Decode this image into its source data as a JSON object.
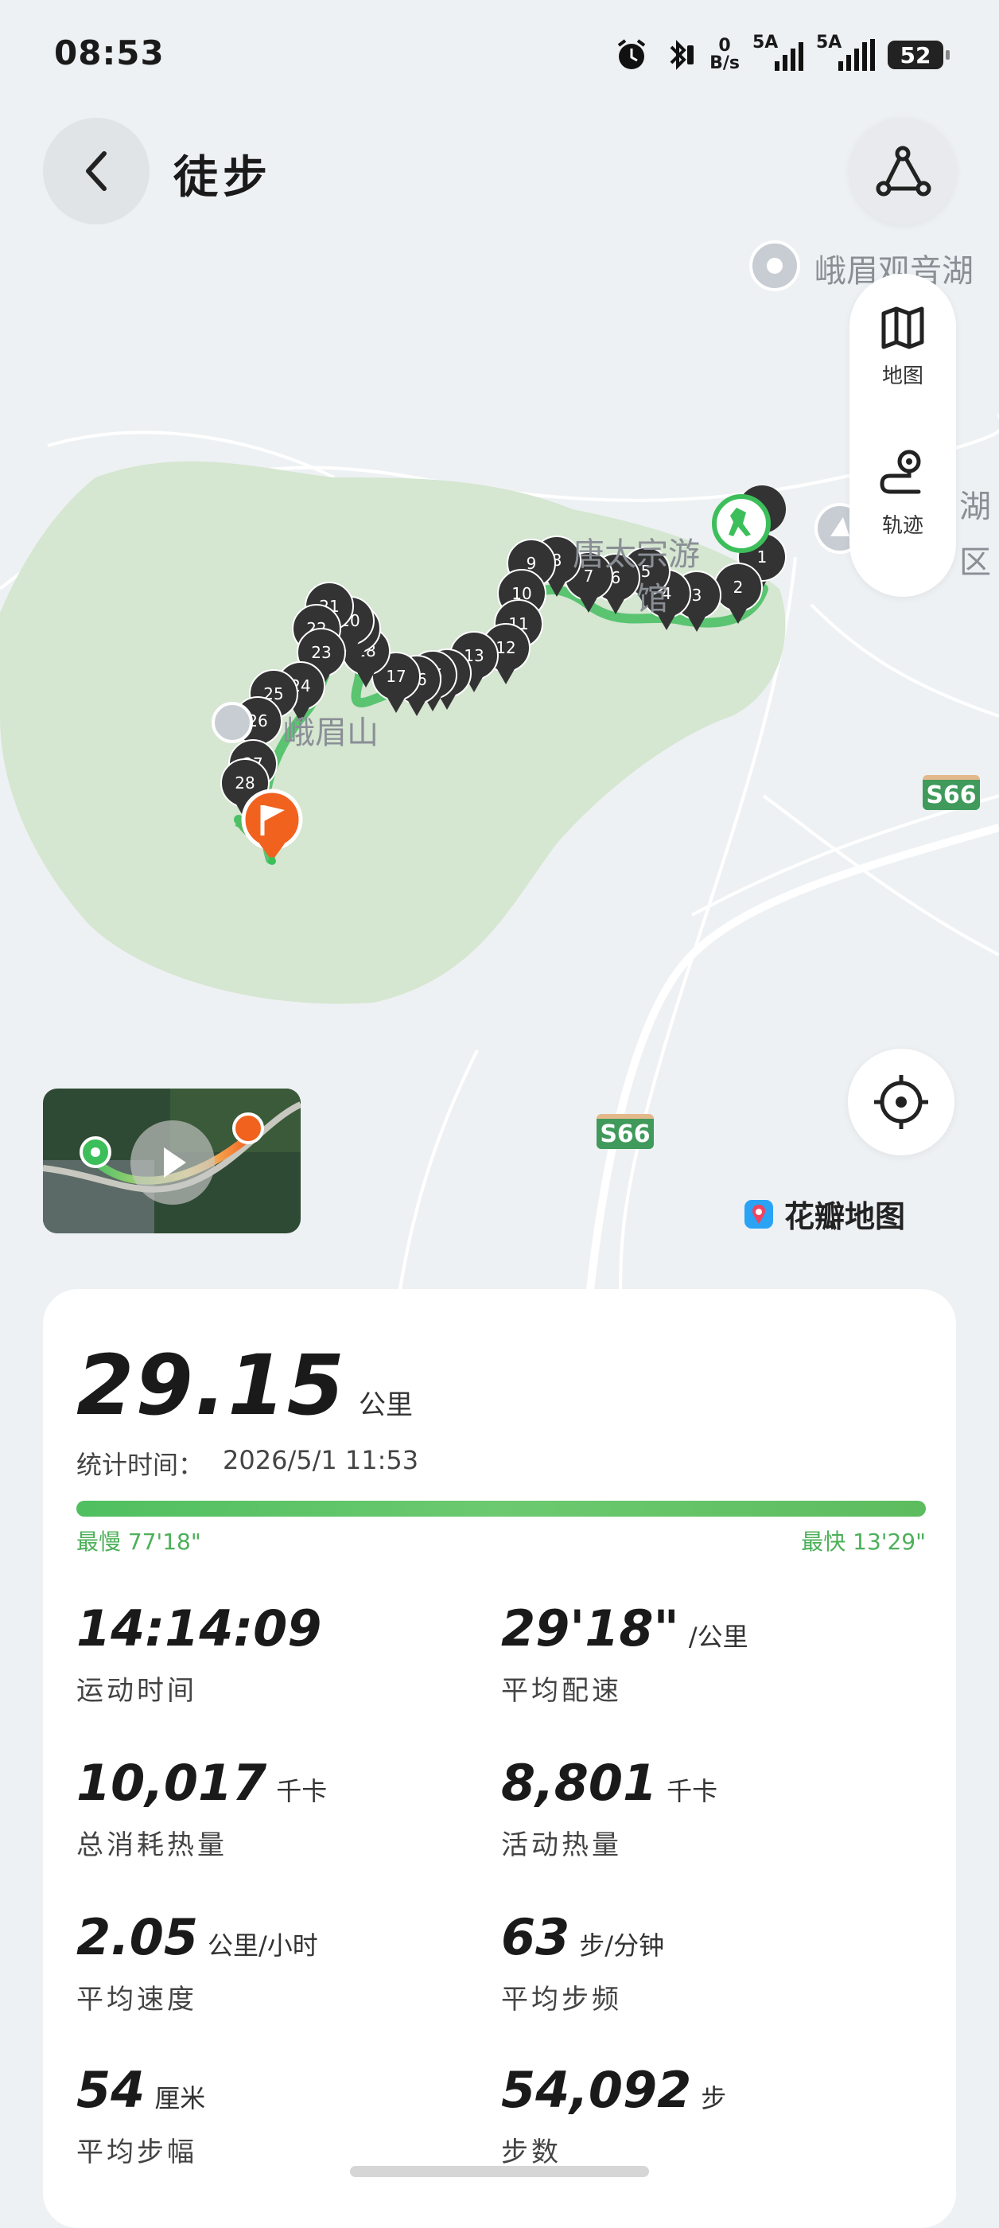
{
  "status_bar": {
    "time": "08:53",
    "net_speed_top": "0",
    "net_speed_bottom": "B/s",
    "signal1_label": "5A",
    "signal2_label": "5A",
    "battery": "52"
  },
  "header": {
    "title": "徒步"
  },
  "layer_panel": {
    "map_label": "地图",
    "track_label": "轨迹"
  },
  "map": {
    "labels": {
      "poi_top": "峨眉观音湖",
      "poi_right_top": "湖",
      "poi_right_bottom": "区",
      "scenic": "唐太宗游",
      "scenic2": "馆",
      "mountain": "峨眉山"
    },
    "road_badges": [
      "S66",
      "S66"
    ],
    "markers": [
      "1",
      "2",
      "3",
      "4",
      "5",
      "6",
      "7",
      "8",
      "9",
      "10",
      "11",
      "12",
      "17",
      "16",
      "23",
      "24",
      "25",
      "26",
      "28"
    ],
    "brand": "花瓣地图"
  },
  "summary": {
    "distance": "29.15",
    "distance_unit": "公里",
    "stat_time_label": "统计时间：",
    "stat_time_value": "2026/5/1 11:53",
    "slowest": "最慢 77'18\"",
    "fastest": "最快 13'29\""
  },
  "metrics": [
    {
      "value": "14:14:09",
      "unit": "",
      "label": "运动时间"
    },
    {
      "value": "29'18\"",
      "unit": "/公里",
      "label": "平均配速"
    },
    {
      "value": "10,017",
      "unit": "千卡",
      "label": "总消耗热量"
    },
    {
      "value": "8,801",
      "unit": "千卡",
      "label": "活动热量"
    },
    {
      "value": "2.05",
      "unit": "公里/小时",
      "label": "平均速度"
    },
    {
      "value": "63",
      "unit": "步/分钟",
      "label": "平均步频"
    },
    {
      "value": "54",
      "unit": "厘米",
      "label": "平均步幅"
    },
    {
      "value": "54,092",
      "unit": "步",
      "label": "步数"
    }
  ],
  "colors": {
    "accent_green": "#4fbf5f",
    "end_orange": "#f2621f",
    "park_green": "#d7e6d3"
  }
}
